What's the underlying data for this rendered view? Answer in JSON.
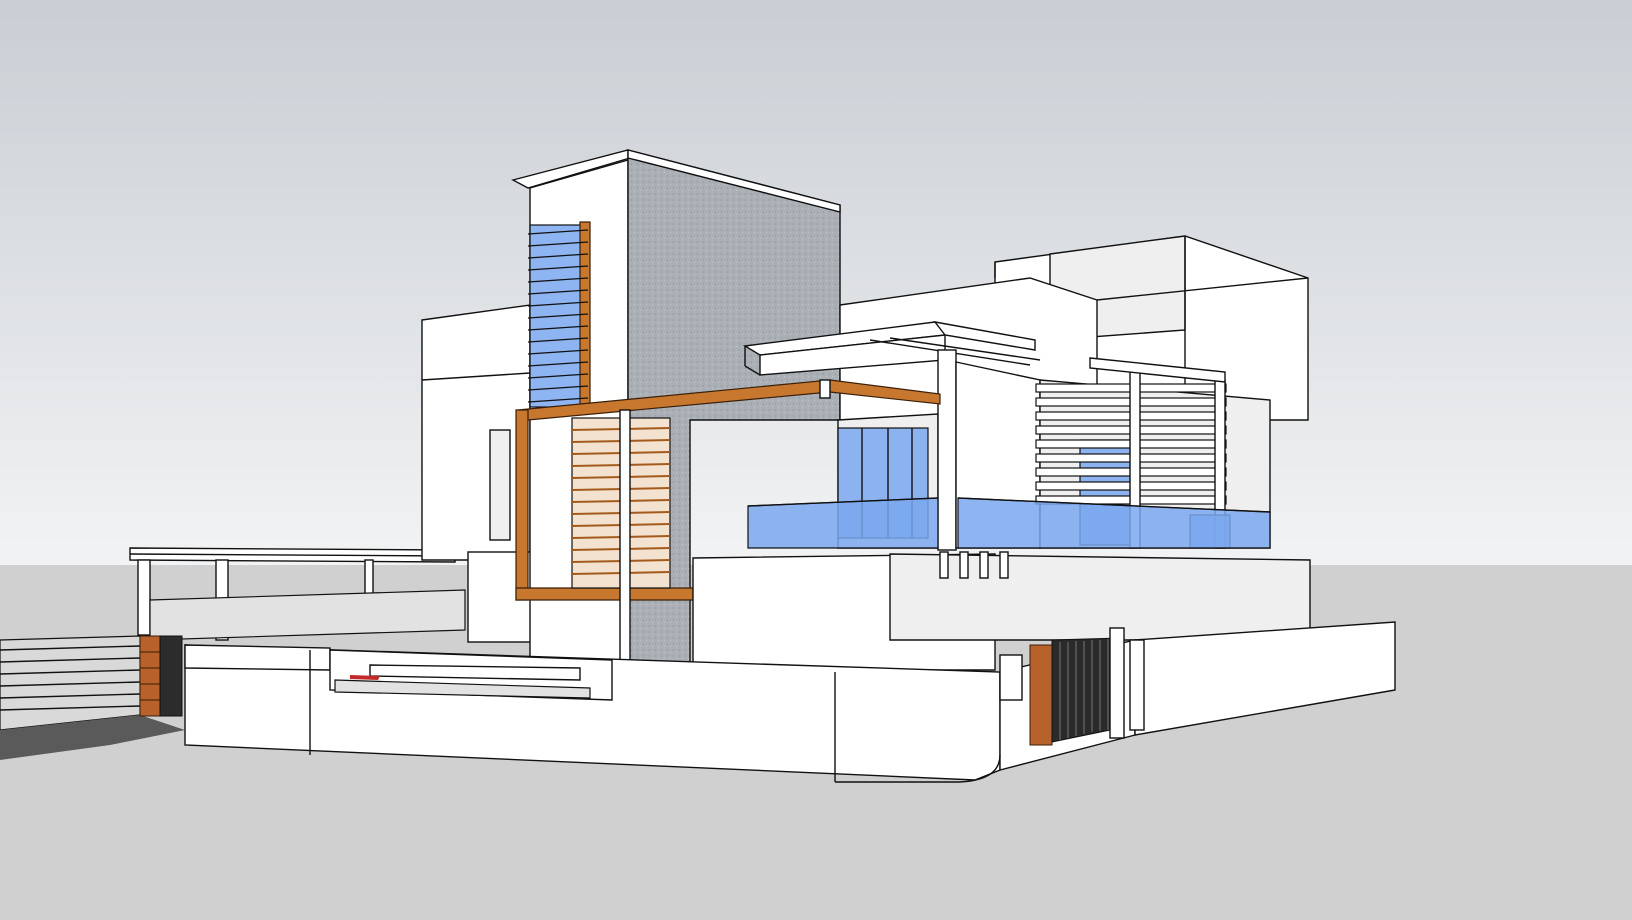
{
  "scene": {
    "kind": "3d-architectural-model",
    "sky_top": "#c9ced4",
    "sky_bottom": "#f2f3f4",
    "ground": "#d0d0d0",
    "concrete": "#a9aeb3",
    "wood": "#c8782e",
    "glass": "#7aa7ef",
    "brick": "#b7622b"
  }
}
